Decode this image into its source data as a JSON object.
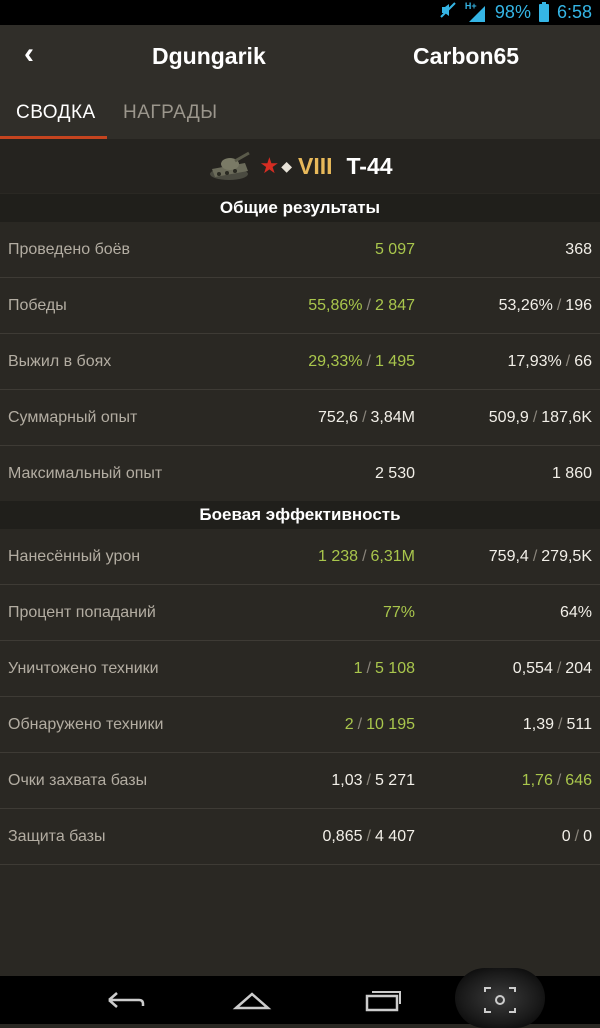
{
  "status_bar": {
    "network_label": "H+",
    "battery": "98%",
    "time": "6:58"
  },
  "header": {
    "back_label": "‹",
    "player_left": "Dgungarik",
    "player_right": "Carbon65"
  },
  "tabs": [
    {
      "label": "СВОДКА",
      "active": true
    },
    {
      "label": "НАГРАДЫ",
      "active": false
    }
  ],
  "tank": {
    "tier": "VIII",
    "name": "T-44",
    "nation_icon": "ussr-star-icon",
    "type_icon": "medium-tank-diamond-icon"
  },
  "sections": {
    "general": "Общие результаты",
    "combat": "Боевая эффективность"
  },
  "general_rows": [
    {
      "label": "Проведено боёв",
      "left": [
        "5 097"
      ],
      "right": [
        "368"
      ]
    },
    {
      "label": "Победы",
      "left": [
        "55,86%",
        "2 847"
      ],
      "right": [
        "53,26%",
        "196"
      ]
    },
    {
      "label": "Выжил в боях",
      "left": [
        "29,33%",
        "1 495"
      ],
      "right": [
        "17,93%",
        "66"
      ]
    },
    {
      "label": "Суммарный опыт",
      "left": [
        "752,6",
        "3,84M"
      ],
      "right": [
        "509,9",
        "187,6K"
      ]
    },
    {
      "label": "Максимальный опыт",
      "left": [
        "2 530"
      ],
      "right": [
        "1 860"
      ]
    }
  ],
  "combat_rows": [
    {
      "label": "Нанесённый урон",
      "left": [
        "1 238",
        "6,31M"
      ],
      "right": [
        "759,4",
        "279,5K"
      ]
    },
    {
      "label": "Процент попаданий",
      "left": [
        "77%"
      ],
      "right": [
        "64%"
      ]
    },
    {
      "label": "Уничтожено техники",
      "left": [
        "1",
        "5 108"
      ],
      "right": [
        "0,554",
        "204"
      ]
    },
    {
      "label": "Обнаружено техники",
      "left": [
        "2",
        "10 195"
      ],
      "right": [
        "1,39",
        "511"
      ]
    },
    {
      "label": "Очки захвата базы",
      "left": [
        "1,03",
        "5 271"
      ],
      "right": [
        "1,76",
        "646"
      ]
    },
    {
      "label": "Защита базы",
      "left": [
        "0,865",
        "4 407"
      ],
      "right": [
        "0",
        "0"
      ]
    }
  ],
  "colors": {
    "better": "#a9c64c",
    "neutral": "#f2efe8",
    "accent": "#c5441f"
  },
  "highlight": {
    "general": [
      "left",
      "left",
      "left",
      "none",
      "none"
    ],
    "combat": [
      "left",
      "left",
      "left",
      "left",
      "right",
      "none"
    ]
  }
}
